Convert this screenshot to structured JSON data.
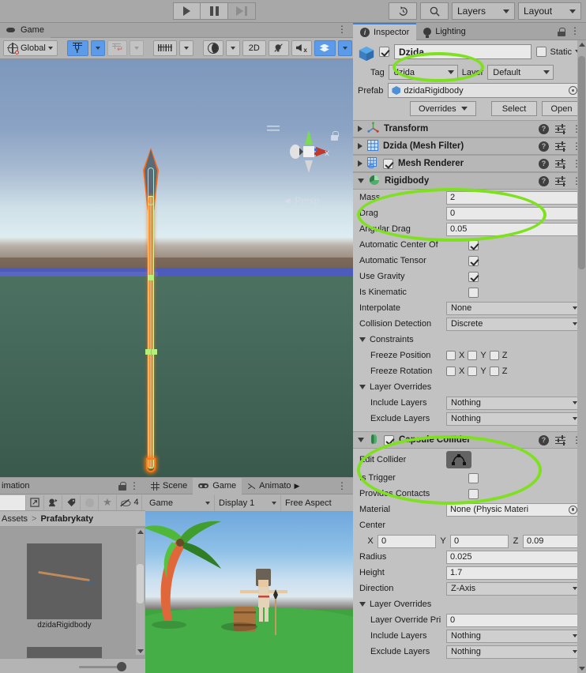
{
  "toolbar": {
    "play_icon": "play-icon",
    "pause_icon": "pause-icon",
    "step_icon": "step-icon",
    "history_icon": "undo-history-icon",
    "search_icon": "search-icon",
    "layers_label": "Layers",
    "layout_label": "Layout"
  },
  "scene_panel": {
    "tab_label": "Game",
    "tab_icon": "game-controller-icon",
    "menu_icon": "kebab-menu-icon",
    "toolbar": {
      "handle_label": "Global",
      "handle_icon": "globe-icon",
      "grid_snap_icon": "grid-y-icon",
      "magnet_icon": "magnet-snap-icon",
      "ruler_icon": "ruler-icon",
      "lighting_icon": "moon-lighting-icon",
      "mode_2d_label": "2D",
      "audio_icon": "audio-mute-icon",
      "fx_icon": "effects-mute-icon",
      "layers_icon": "scene-layers-icon",
      "visibility_icon": "eye-slash-icon"
    },
    "gizmo": {
      "axis_x": "x",
      "axis_y": "y",
      "projection_label": "Persp",
      "projection_arrow": "◄",
      "lock_icon": "gizmo-lock-icon",
      "hamburger_icon": "hamburger-icon"
    }
  },
  "animation_panel": {
    "tab_label": "imation",
    "lock_icon": "lock-icon",
    "menu_icon": "kebab-menu-icon",
    "toolbar": {
      "popout_icon": "popout-icon",
      "avatar_icon": "avatar-mask-icon",
      "tag_icon": "tag-icon",
      "circle_icon": "circle-icon",
      "favorite_icon": "star-icon",
      "hidden_icon": "eye-slash-icon",
      "hidden_count": "4"
    },
    "breadcrumb": {
      "root": "Assets",
      "separator": ">",
      "current": "Prafabrykaty"
    },
    "assets": [
      {
        "name": "dzidaRigidbody"
      },
      {
        "name": ""
      }
    ]
  },
  "game_panel": {
    "tabs": [
      {
        "label": "Scene",
        "icon": "grid-hash-icon",
        "active": false
      },
      {
        "label": "Game",
        "icon": "game-controller-icon",
        "active": true
      },
      {
        "label": "Animato",
        "icon": "animator-icon",
        "active": false
      }
    ],
    "tab_overflow_icon": "chevron-right-icon",
    "menu_icon": "kebab-menu-icon",
    "toolbar": {
      "target_label": "Game",
      "display_label": "Display 1",
      "aspect_label": "Free Aspect"
    }
  },
  "inspector": {
    "tabs": [
      {
        "label": "Inspector",
        "icon": "info-icon",
        "active": true
      },
      {
        "label": "Lighting",
        "icon": "lightbulb-icon",
        "active": false
      }
    ],
    "lock_icon": "lock-icon",
    "menu_icon": "kebab-menu-icon",
    "object": {
      "enabled": true,
      "icon": "cube-icon",
      "name": "Dzida",
      "static_label": "Static",
      "static_checked": false,
      "tag_label": "Tag",
      "tag_value": "dzida",
      "layer_label": "Layer",
      "layer_value": "Default",
      "prefab_label": "Prefab",
      "prefab_value": "dzidaRigidbody",
      "prefab_icon": "prefab-icon",
      "object_picker_icon": "object-picker-icon",
      "overrides_label": "Overrides",
      "select_label": "Select",
      "open_label": "Open"
    },
    "components": [
      {
        "name": "Transform",
        "icon": "transform-axis-icon",
        "expanded": false,
        "has_checkbox": false,
        "help_icon": "help-icon",
        "preset_icon": "preset-icon",
        "menu_icon": "kebab-menu-icon"
      },
      {
        "name": "Dzida (Mesh Filter)",
        "icon": "mesh-filter-icon",
        "expanded": false,
        "has_checkbox": false,
        "help_icon": "help-icon",
        "preset_icon": "preset-icon",
        "menu_icon": "kebab-menu-icon"
      },
      {
        "name": "Mesh Renderer",
        "icon": "mesh-renderer-icon",
        "expanded": false,
        "has_checkbox": true,
        "checked": true,
        "help_icon": "help-icon",
        "preset_icon": "preset-icon",
        "menu_icon": "kebab-menu-icon"
      }
    ],
    "rigidbody": {
      "title": "Rigidbody",
      "icon": "rigidbody-icon",
      "expanded": true,
      "help_icon": "help-icon",
      "preset_icon": "preset-icon",
      "menu_icon": "kebab-menu-icon",
      "mass_label": "Mass",
      "mass_value": "2",
      "drag_label": "Drag",
      "drag_value": "0",
      "angular_drag_label": "Angular Drag",
      "angular_drag_value": "0.05",
      "auto_center_label": "Automatic Center Of",
      "auto_center_checked": true,
      "auto_tensor_label": "Automatic Tensor",
      "auto_tensor_checked": true,
      "use_gravity_label": "Use Gravity",
      "use_gravity_checked": true,
      "is_kinematic_label": "Is Kinematic",
      "is_kinematic_checked": false,
      "interpolate_label": "Interpolate",
      "interpolate_value": "None",
      "collision_label": "Collision Detection",
      "collision_value": "Discrete",
      "constraints_label": "Constraints",
      "freeze_position_label": "Freeze Position",
      "freeze_rotation_label": "Freeze Rotation",
      "axis_x": "X",
      "axis_y": "Y",
      "axis_z": "Z",
      "layer_overrides_label": "Layer Overrides",
      "include_layers_label": "Include Layers",
      "include_layers_value": "Nothing",
      "exclude_layers_label": "Exclude Layers",
      "exclude_layers_value": "Nothing"
    },
    "capsule_collider": {
      "title": "Capsule Collider",
      "icon": "capsule-collider-icon",
      "expanded": true,
      "enabled": true,
      "help_icon": "help-icon",
      "preset_icon": "preset-icon",
      "menu_icon": "kebab-menu-icon",
      "edit_collider_label": "Edit Collider",
      "edit_collider_icon": "edit-collider-icon",
      "is_trigger_label": "Is Trigger",
      "is_trigger_checked": false,
      "provides_contacts_label": "Provides Contacts",
      "provides_contacts_checked": false,
      "material_label": "Material",
      "material_value": "None (Physic Materi",
      "object_picker_icon": "object-picker-icon",
      "center_label": "Center",
      "center_x_label": "X",
      "center_x": "0",
      "center_y_label": "Y",
      "center_y": "0",
      "center_z_label": "Z",
      "center_z": "0.09",
      "radius_label": "Radius",
      "radius_value": "0.025",
      "height_label": "Height",
      "height_value": "1.7",
      "direction_label": "Direction",
      "direction_value": "Z-Axis",
      "layer_overrides_label": "Layer Overrides",
      "priority_label": "Layer Override Pri",
      "priority_value": "0",
      "include_layers_label": "Include Layers",
      "include_layers_value": "Nothing",
      "exclude_layers_label": "Exclude Layers",
      "exclude_layers_value": "Nothing"
    }
  },
  "annotations": {
    "accent_color": "#7ee01e",
    "highlights": [
      "tag-field",
      "rigidbody-mass-drag",
      "capsule-collider-edit"
    ]
  }
}
